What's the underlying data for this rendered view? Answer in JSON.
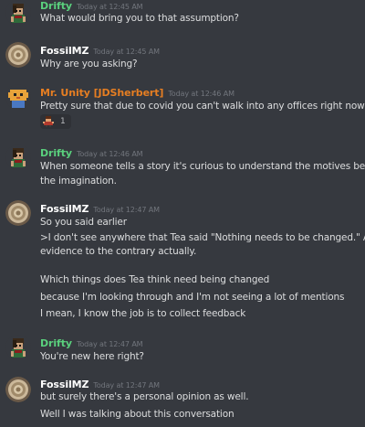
{
  "colors": {
    "background": "#36393f",
    "drifty_name": "#5ad07d",
    "fossilmz_name": "#ffffff",
    "unity_name": "#e67e22",
    "message_text": "#dcddde",
    "timestamp": "#72767d"
  },
  "messages": [
    {
      "username": "Drifty",
      "timestamp": "Today at 12:45 AM",
      "lines": [
        "What would bring you to that assumption?"
      ]
    },
    {
      "username": "FossilMZ",
      "timestamp": "Today at 12:45 AM",
      "lines": [
        "Why are you asking?"
      ]
    },
    {
      "username": "Mr. Unity [JDSherbert]",
      "timestamp": "Today at 12:46 AM",
      "lines": [
        "Pretty sure that due to covid you can't walk into any offices right now"
      ],
      "reaction": {
        "emoji": "custom-character-emoji",
        "count": "1"
      }
    },
    {
      "username": "Drifty",
      "timestamp": "Today at 12:46 AM",
      "lines": [
        "When someone tells a story it's curious to understand the motives behind",
        "the imagination."
      ]
    },
    {
      "username": "FossilMZ",
      "timestamp": "Today at 12:47 AM",
      "lines": [
        "So you said earlier",
        ">I don't see anywhere that Tea said \"Nothing needs to be changed.\" All",
        "evidence to the contrary actually.",
        "Which things does Tea think need being changed",
        "because I'm looking through and I'm not seeing a lot of mentions",
        "I mean, I know the job is to collect feedback"
      ]
    },
    {
      "username": "Drifty",
      "timestamp": "Today at 12:47 AM",
      "lines": [
        "You're new here right?"
      ]
    },
    {
      "username": "FossilMZ",
      "timestamp": "Today at 12:47 AM",
      "lines": [
        "but surely there's a personal opinion as well.",
        "Well I was talking about this conversation"
      ]
    }
  ]
}
